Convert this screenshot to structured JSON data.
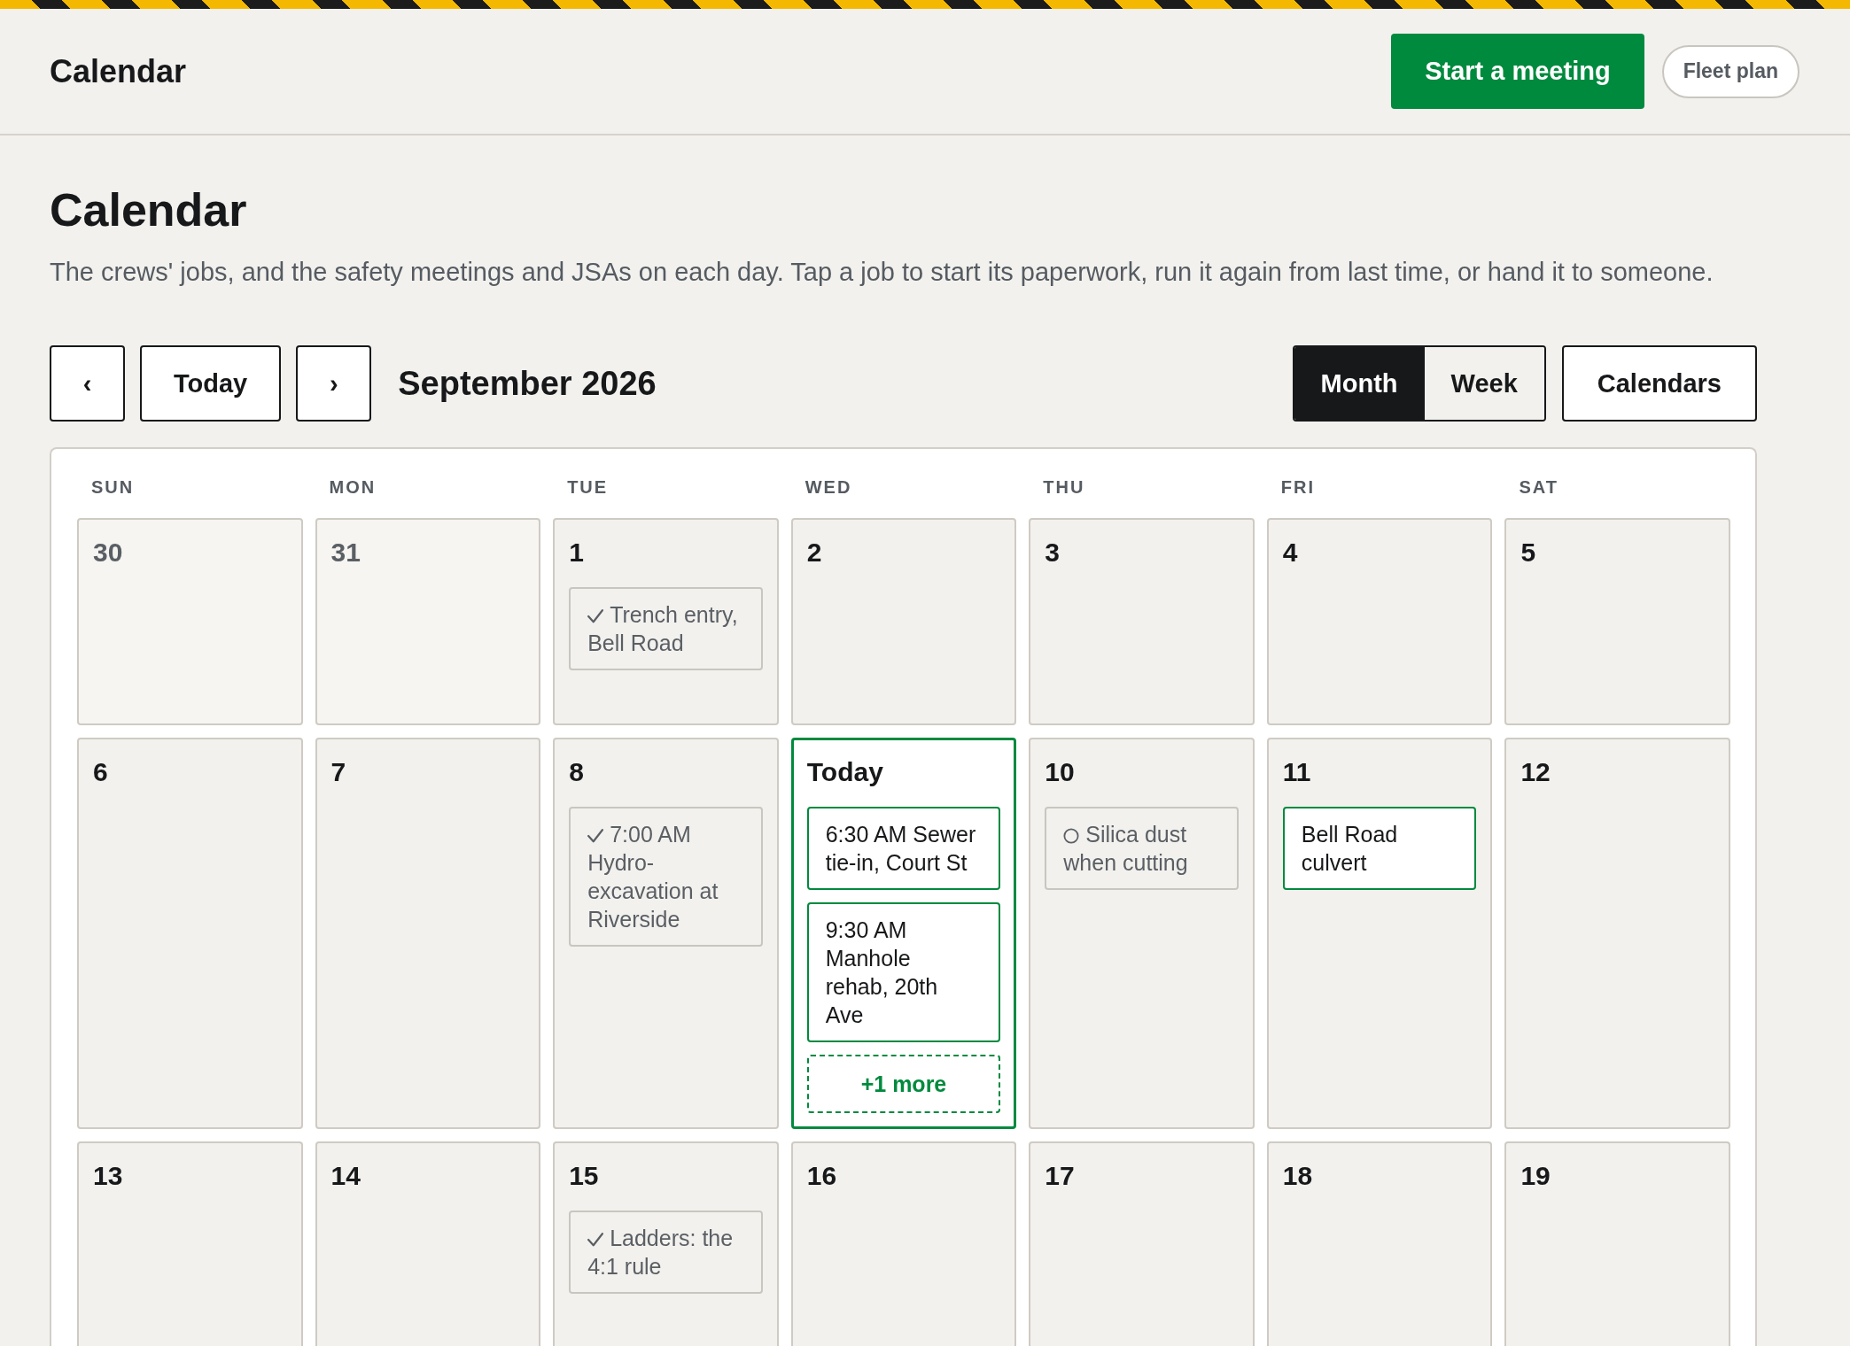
{
  "top_bar": {
    "title": "Calendar",
    "buttons": [
      {
        "label": "Start a meeting",
        "kind": "primary"
      },
      {
        "label": "Fleet plan",
        "kind": "pill"
      }
    ]
  },
  "page": {
    "title": "Calendar",
    "description": "The crews' jobs, and the safety meetings and JSAs on each day. Tap a job to start its paperwork, run it again from last time, or hand it to someone."
  },
  "toolbar": {
    "prev": "‹",
    "today": "Today",
    "next": "›",
    "period": "September 2026",
    "views": [
      {
        "label": "Month",
        "selected": true
      },
      {
        "label": "Week",
        "selected": false
      }
    ],
    "calendars": "Calendars"
  },
  "calendar": {
    "weekdays": [
      "SUN",
      "MON",
      "TUE",
      "WED",
      "THU",
      "FRI",
      "SAT"
    ],
    "weeks": [
      [
        {
          "day": "30",
          "in_month": false,
          "today": false
        },
        {
          "day": "31",
          "in_month": false,
          "today": false
        },
        {
          "day": "1",
          "in_month": true,
          "today": false,
          "events": [
            {
              "text": "Trench entry, Bell Road",
              "kind": "done"
            }
          ]
        },
        {
          "day": "2",
          "in_month": true,
          "today": false
        },
        {
          "day": "3",
          "in_month": true,
          "today": false
        },
        {
          "day": "4",
          "in_month": true,
          "today": false
        },
        {
          "day": "5",
          "in_month": true,
          "today": false
        }
      ],
      [
        {
          "day": "6",
          "in_month": true,
          "today": false
        },
        {
          "day": "7",
          "in_month": true,
          "today": false
        },
        {
          "day": "8",
          "in_month": true,
          "today": false,
          "events": [
            {
              "text": "7:00 AM Hydro-excavation at Riverside",
              "kind": "done"
            }
          ]
        },
        {
          "day": "Today",
          "in_month": true,
          "today": true,
          "events": [
            {
              "text": "6:30 AM Sewer tie-in, Court St",
              "kind": "scheduled"
            },
            {
              "text": "9:30 AM Manhole rehab, 20th Ave",
              "kind": "scheduled"
            }
          ],
          "more": "+1 more"
        },
        {
          "day": "10",
          "in_month": true,
          "today": false,
          "events": [
            {
              "text": "Silica dust when cutting",
              "kind": "pending"
            }
          ]
        },
        {
          "day": "11",
          "in_month": true,
          "today": false,
          "events": [
            {
              "text": "Bell Road culvert",
              "kind": "scheduled"
            }
          ]
        },
        {
          "day": "12",
          "in_month": true,
          "today": false
        }
      ],
      [
        {
          "day": "13",
          "in_month": true,
          "today": false
        },
        {
          "day": "14",
          "in_month": true,
          "today": false
        },
        {
          "day": "15",
          "in_month": true,
          "today": false,
          "events": [
            {
              "text": "Ladders: the 4:1 rule",
              "kind": "done"
            }
          ]
        },
        {
          "day": "16",
          "in_month": true,
          "today": false
        },
        {
          "day": "17",
          "in_month": true,
          "today": false
        },
        {
          "day": "18",
          "in_month": true,
          "today": false
        },
        {
          "day": "19",
          "in_month": true,
          "today": false
        }
      ]
    ]
  }
}
